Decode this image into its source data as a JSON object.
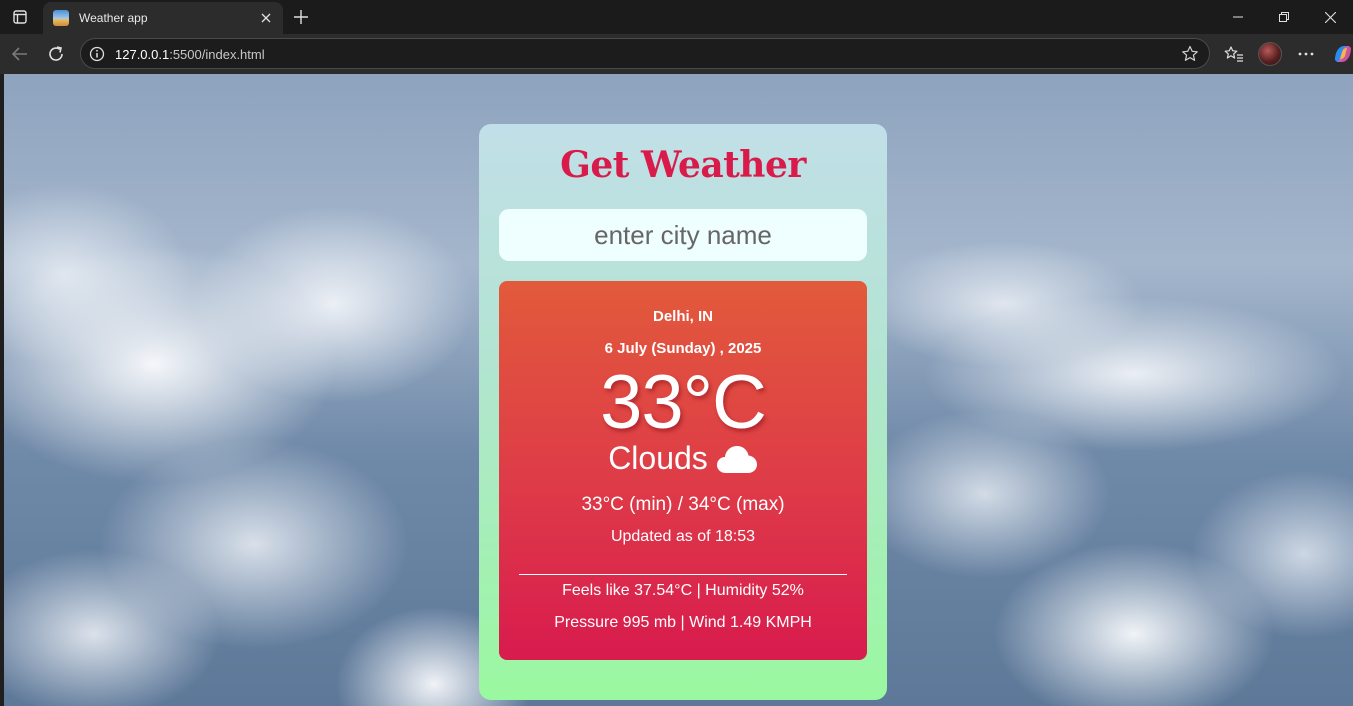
{
  "browser": {
    "tab_title": "Weather app",
    "url_host": "127.0.0.1",
    "url_rest": ":5500/index.html"
  },
  "page": {
    "title": "Get Weather",
    "search": {
      "placeholder": "enter city name",
      "value": ""
    },
    "weather": {
      "location": "Delhi, IN",
      "date": "6 July (Sunday) , 2025",
      "temperature": "33°C",
      "condition": "Clouds",
      "condition_icon": "cloud-icon",
      "min_max": "33°C (min) / 34°C (max)",
      "updated": "Updated as of 18:53",
      "feels_humidity": "Feels like 37.54°C | Humidity 52%",
      "pressure_wind": "Pressure 995 mb | Wind 1.49 KMPH"
    }
  },
  "colors": {
    "title": "#d81b4a",
    "result_top": "#e25a3b",
    "result_bottom": "#d81b4e",
    "card_top": "#c1dfe8",
    "card_bottom": "#9af8a0"
  }
}
